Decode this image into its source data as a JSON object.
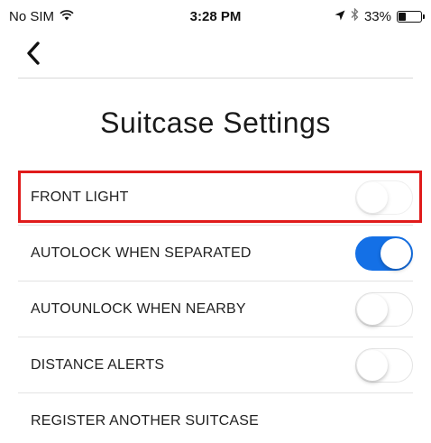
{
  "status_bar": {
    "carrier": "No SIM",
    "wifi_icon": "wifi-icon",
    "time": "3:28 PM",
    "location_icon": "location-arrow-icon",
    "bluetooth_icon": "bluetooth-icon",
    "battery_percent": "33%",
    "battery_level": 0.33
  },
  "nav": {
    "back_icon": "chevron-left-icon"
  },
  "page": {
    "title": "Suitcase Settings"
  },
  "settings": [
    {
      "label": "FRONT LIGHT",
      "toggle": "off",
      "highlighted": true
    },
    {
      "label": "AUTOLOCK WHEN SEPARATED",
      "toggle": "on"
    },
    {
      "label": "AUTOUNLOCK WHEN NEARBY",
      "toggle": "off"
    },
    {
      "label": "DISTANCE ALERTS",
      "toggle": "off"
    },
    {
      "label": "REGISTER ANOTHER SUITCASE"
    }
  ],
  "colors": {
    "accent": "#1470e6",
    "highlight": "#e01b1b"
  }
}
